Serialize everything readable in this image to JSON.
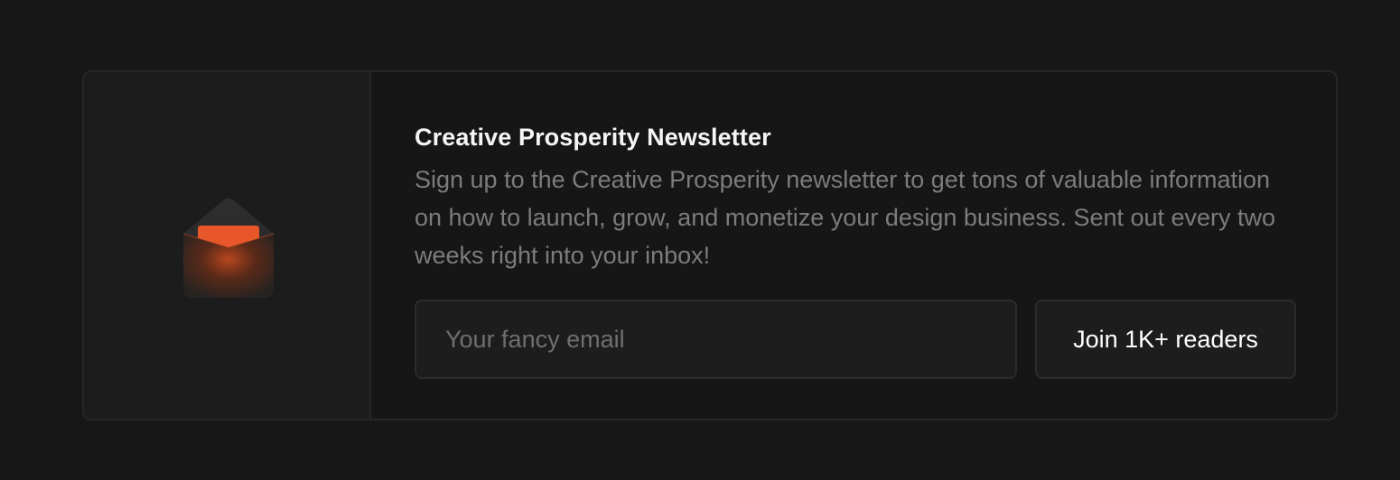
{
  "newsletter": {
    "icon": "envelope-icon",
    "title": "Creative Prosperity Newsletter",
    "description": "Sign up to the Creative Prosperity newsletter to get tons of valuable information on how to launch, grow, and monetize your design business. Sent out every two weeks right into your inbox!",
    "email_input": {
      "placeholder": "Your fancy email",
      "value": ""
    },
    "join_button_label": "Join 1K+ readers"
  },
  "colors": {
    "background": "#171717",
    "card_border": "#262626",
    "accent": "#e8572a",
    "title": "#f5f5f5",
    "description": "#7c7c7c"
  }
}
